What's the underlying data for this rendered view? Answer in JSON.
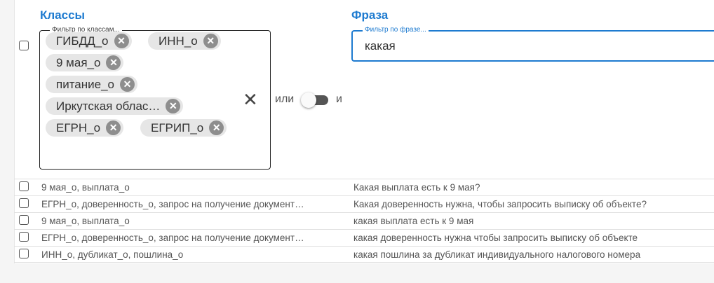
{
  "headers": {
    "classes": "Классы",
    "phrase": "Фраза"
  },
  "class_filter": {
    "placeholder": "Фильтр по классам...",
    "chips": [
      "ГИБДД_о",
      "ИНН_о",
      "9 мая_о",
      "питание_о",
      "Иркутская облас…",
      "ЕГРН_о",
      "ЕГРИП_о"
    ],
    "clear_icon": "close-icon",
    "chip_remove_icon": "x-circle-icon"
  },
  "logic_toggle": {
    "or_label": "или",
    "and_label": "и",
    "state": "or"
  },
  "phrase_filter": {
    "placeholder": "Фильтр по фразе...",
    "value": "какая"
  },
  "rows": [
    {
      "classes": "9 мая_о, выплата_о",
      "phrase": "Какая выплата есть к 9 мая?"
    },
    {
      "classes": "ЕГРН_о, доверенность_о, запрос на получение документ…",
      "phrase": "Какая доверенность нужна, чтобы запросить выписку об объекте?"
    },
    {
      "classes": "9 мая_о, выплата_о",
      "phrase": "какая выплата есть к 9 мая"
    },
    {
      "classes": "ЕГРН_о, доверенность_о, запрос на получение документ…",
      "phrase": "какая доверенность нужна чтобы запросить выписку об объекте"
    },
    {
      "classes": "ИНН_о, дубликат_о, пошлина_о",
      "phrase": "какая пошлина за дубликат индивидуального налогового номера"
    }
  ],
  "colors": {
    "accent": "#1e7bd0",
    "chip_bg": "#e6e6e6",
    "chip_x": "#8e8e8e"
  }
}
